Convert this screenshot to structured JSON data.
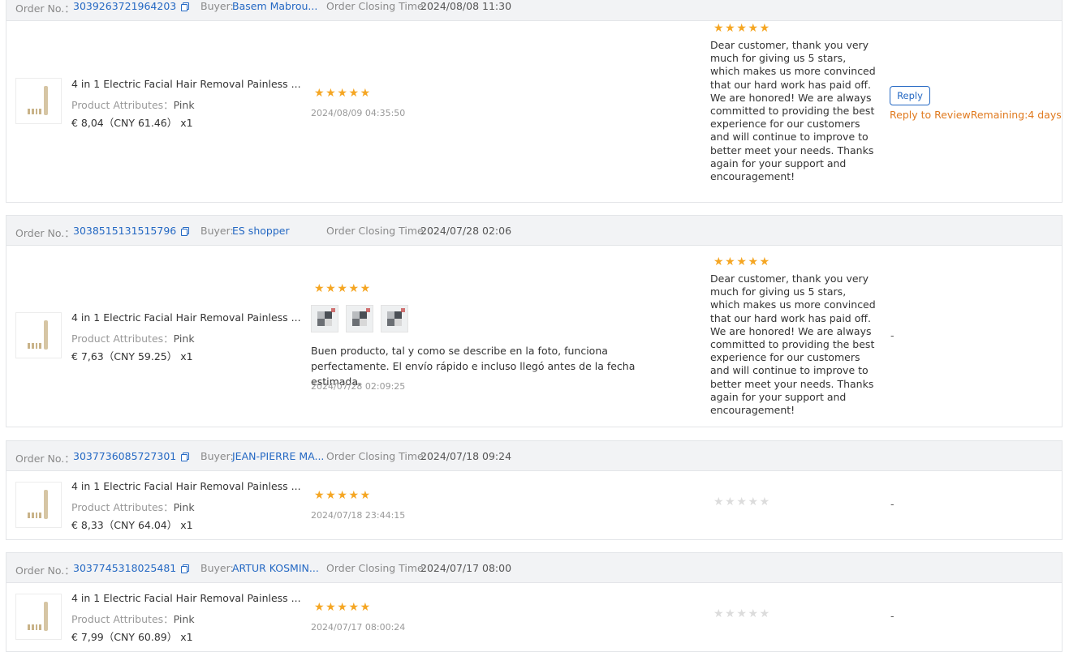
{
  "labels": {
    "order_no": "Order No.：",
    "buyer": "Buyer:",
    "closing": "Order Closing Time:",
    "attr_prefix": "Product Attributes："
  },
  "icons": {
    "copy": "copy-icon",
    "star": "star-icon"
  },
  "colors": {
    "star_filled": "#f5a623",
    "star_empty": "#dcdcdc",
    "link": "#2468c3",
    "remaining": "#e07a1f"
  },
  "orders": [
    {
      "order_no": "3039263721964203",
      "buyer": "Basem Mabrou...",
      "closing_time": "2024/08/08 11:30",
      "product": {
        "name": "4 in 1 Electric Facial Hair Removal Painless ...",
        "attr": "Pink",
        "price": "€ 8,04（CNY  61.46） x1"
      },
      "review": {
        "rating": 5,
        "date": "2024/08/09 04:35:50",
        "text": "",
        "photos": 0
      },
      "reply": {
        "rating": 5,
        "text": "Dear customer, thank you very much for giving us 5 stars, which makes us more convinced that our hard work has paid off. We are honored! We are always committed to providing the best experience for our customers and will continue to improve to better meet your needs. Thanks again for your support and encouragement!"
      },
      "action": {
        "button": "Reply",
        "remaining": "Reply to ReviewRemaining:4 days"
      }
    },
    {
      "order_no": "3038515131515796",
      "buyer": "ES shopper",
      "closing_time": "2024/07/28 02:06",
      "product": {
        "name": "4 in 1 Electric Facial Hair Removal Painless ...",
        "attr": "Pink",
        "price": "€ 7,63（CNY  59.25） x1"
      },
      "review": {
        "rating": 5,
        "date": "2024/07/28 02:09:25",
        "text": "Buen producto, tal y como se describe en la foto, funciona perfectamente. El envío rápido e incluso llegó antes de la fecha estimada.",
        "photos": 3
      },
      "reply": {
        "rating": 5,
        "text": "Dear customer, thank you very much for giving us 5 stars, which makes us more convinced that our hard work has paid off. We are honored! We are always committed to providing the best experience for our customers and will continue to improve to better meet your needs. Thanks again for your support and encouragement!"
      },
      "action": {
        "dash": "-"
      }
    },
    {
      "order_no": "3037736085727301",
      "buyer": "JEAN-PIERRE MA...",
      "closing_time": "2024/07/18 09:24",
      "product": {
        "name": "4 in 1 Electric Facial Hair Removal Painless ...",
        "attr": "Pink",
        "price": "€ 8,33（CNY  64.04） x1"
      },
      "review": {
        "rating": 5,
        "date": "2024/07/18 23:44:15",
        "text": "",
        "photos": 0
      },
      "reply": {
        "rating": 0
      },
      "action": {
        "dash": "-"
      }
    },
    {
      "order_no": "3037745318025481",
      "buyer": "ARTUR KOSMIN...",
      "closing_time": "2024/07/17 08:00",
      "product": {
        "name": "4 in 1 Electric Facial Hair Removal Painless ...",
        "attr": "Pink",
        "price": "€ 7,99（CNY  60.89） x1"
      },
      "review": {
        "rating": 5,
        "date": "2024/07/17 08:00:24",
        "text": "",
        "photos": 0
      },
      "reply": {
        "rating": 0
      },
      "action": {
        "dash": "-"
      }
    }
  ]
}
